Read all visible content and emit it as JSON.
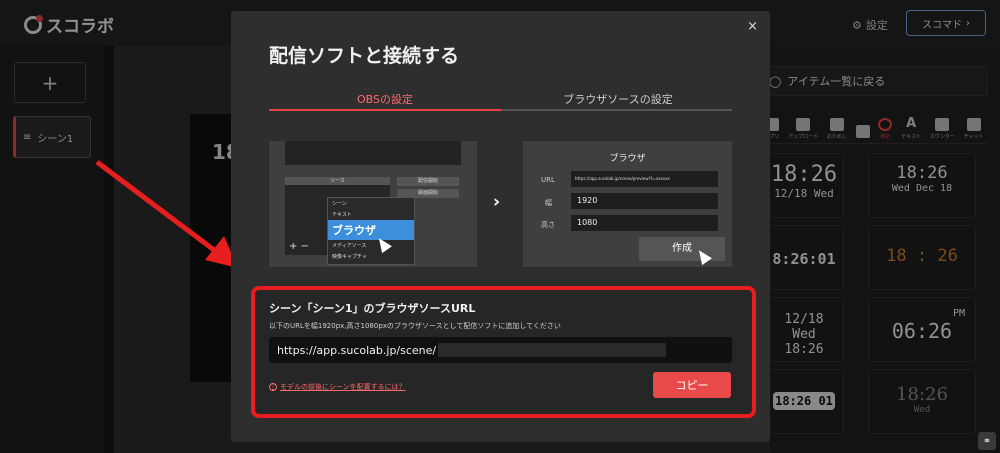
{
  "app": {
    "logo": "スコラボ",
    "settings": "設定",
    "sukomado": "スコマド"
  },
  "left": {
    "add": "+",
    "scene_label": "シーン1"
  },
  "preview": {
    "text": "18"
  },
  "right": {
    "back": "アイテム一覧に戻る",
    "categories": [
      "ップリ",
      "アップロード",
      "おためし",
      "",
      "時計",
      "テキスト",
      "カウンター",
      "チャット"
    ],
    "tiles": [
      {
        "main": "18:26",
        "sub": "12/18 Wed"
      },
      {
        "main": "18:26",
        "sub": "Wed Dec 18"
      },
      {
        "main": "8:26:01",
        "sub": ""
      },
      {
        "main": "18 : 26",
        "sub": ""
      },
      {
        "main": "12/18 Wed 18:26",
        "sub": ""
      },
      {
        "main": "06:26",
        "sub": "PM"
      },
      {
        "main": "18:26 01",
        "sub": ""
      },
      {
        "main": "18:26",
        "sub": "Wed"
      }
    ]
  },
  "modal": {
    "title": "配信ソフトと接続する",
    "close": "×",
    "tab_obs": "OBSの設定",
    "tab_browser": "ブラウザソースの設定",
    "illus_left": {
      "source": "ソース",
      "btn1": "配信開始",
      "btn2": "録画開始",
      "menu": [
        "シーン",
        "テキスト",
        "ブラウザ",
        "メディアソース",
        "映像キャプチャ"
      ]
    },
    "illus_right": {
      "title": "ブラウザ",
      "url_label": "URL",
      "url_val": "https://app.sucolab.jp/scene/preview?t=xxxxxx",
      "w_label": "幅",
      "w_val": "1920",
      "h_label": "高さ",
      "h_val": "1080",
      "create": "作成"
    },
    "url_section": {
      "title": "シーン「シーン1」のブラウザソースURL",
      "desc": "以下のURLを幅1920px,高さ1080pxのブラウザソースとして配信ソフトに追加してください",
      "url": "https://app.sucolab.jp/scene/",
      "help": "モデルの前後にシーンを配置するには？",
      "copy": "コピー"
    }
  }
}
